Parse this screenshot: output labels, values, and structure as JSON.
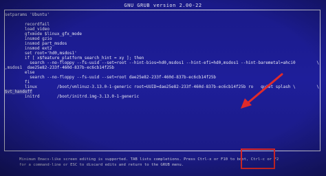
{
  "header": {
    "title": "GNU GRUB  version 2.00-22"
  },
  "editor": {
    "lines": [
      "setparams 'Ubuntu'",
      "",
      "        recordfail",
      "        load_video",
      "        gfxmode $linux_gfx_mode",
      "        insmod gzio",
      "        insmod part_msdos",
      "        insmod ext2",
      "        set root='hd0,msdos1'",
      "        if [ x$feature_platform_search_hint = xy ]; then",
      "          search --no-floppy --fs-uuid --set=root --hint-bios=hd0,msdos1 --hint-efi=hd0,msdos1 --hint-baremetal=ahci0",
      ",msdos1  dae25e82-233f-460d-837b-ec6cb14f25b",
      "        else",
      "          search --no-floppy --fs-uuid --set=root dae25e82-233f-460d-837b-ec6cb14f25b",
      "        fi",
      "        linux        /boot/vmlinuz-3.13.0-1-generic root=UUID=dae25e82-233f-460d-837b-ec6cb14f25b ro   quiet splash \\",
      "$vt_handoff",
      "        initrd       /boot/initrd.img-3.13.0-1-generic"
    ],
    "overflow_marks": [
      "\\",
      "\\"
    ]
  },
  "footer": {
    "lines": [
      "Minimum Emacs-like screen editing is supported. TAB lists completions. Press Ctrl-x or F10 to boot, Ctrl-c or F2",
      "for a command-line or ESC to discard edits and return to the GRUB menu."
    ]
  },
  "colors": {
    "background": "#1e1e9a",
    "text": "#e8e8f4",
    "annotation": "#e02a2a"
  }
}
